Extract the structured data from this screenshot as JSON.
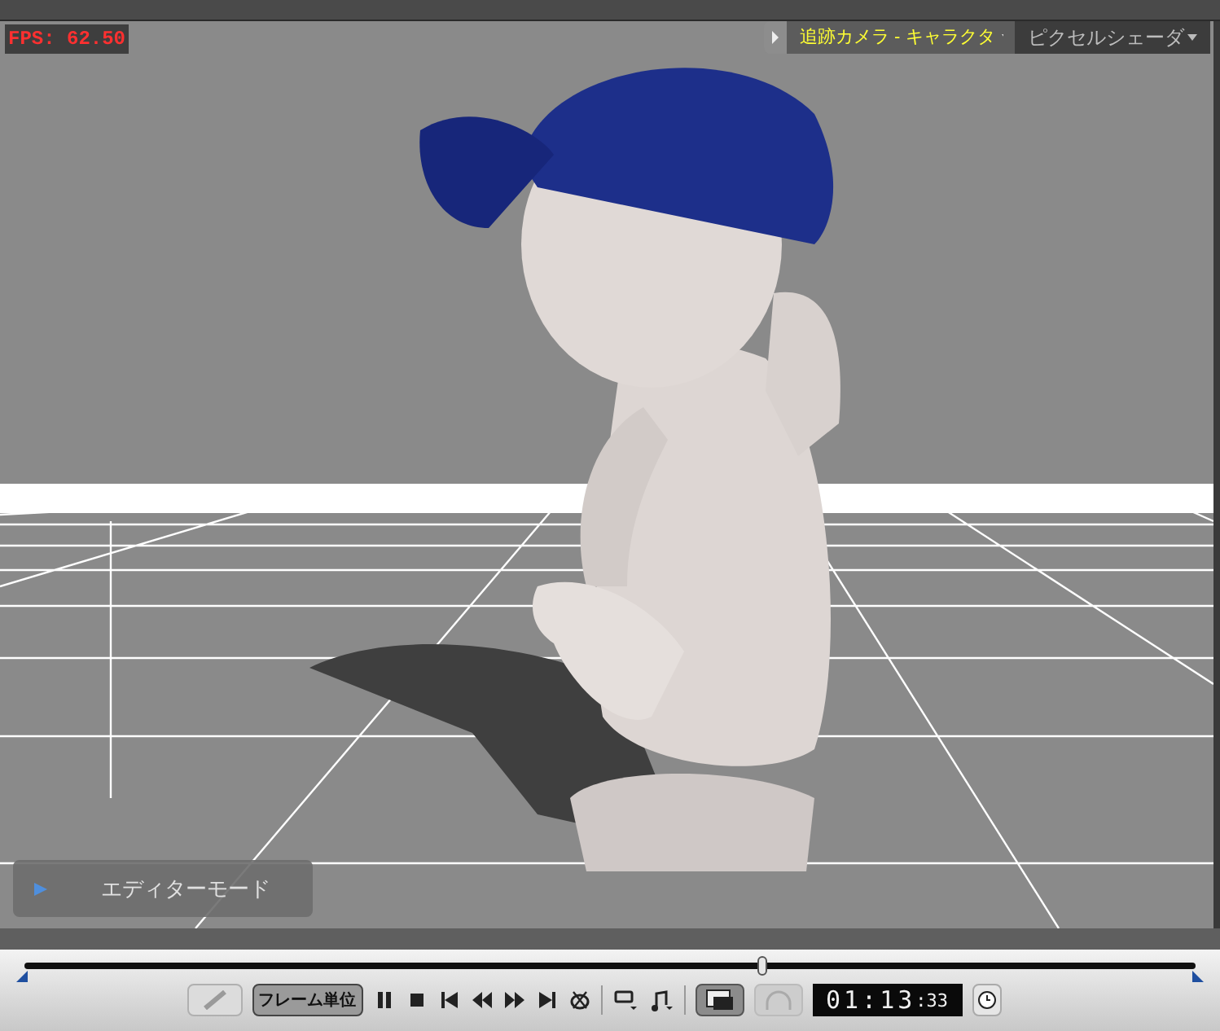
{
  "viewport": {
    "fps": "FPS: 62.50",
    "camera_menu": "追跡カメラ - キャラクタ",
    "shader_menu": "ピクセルシェーダ",
    "mode_label": "エディターモード"
  },
  "timeline": {
    "level": 0.63,
    "frame_toggle": {
      "label": "フレーム単位",
      "selected": true
    },
    "timecode_main": "01:13",
    "timecode_frames": ":33"
  }
}
